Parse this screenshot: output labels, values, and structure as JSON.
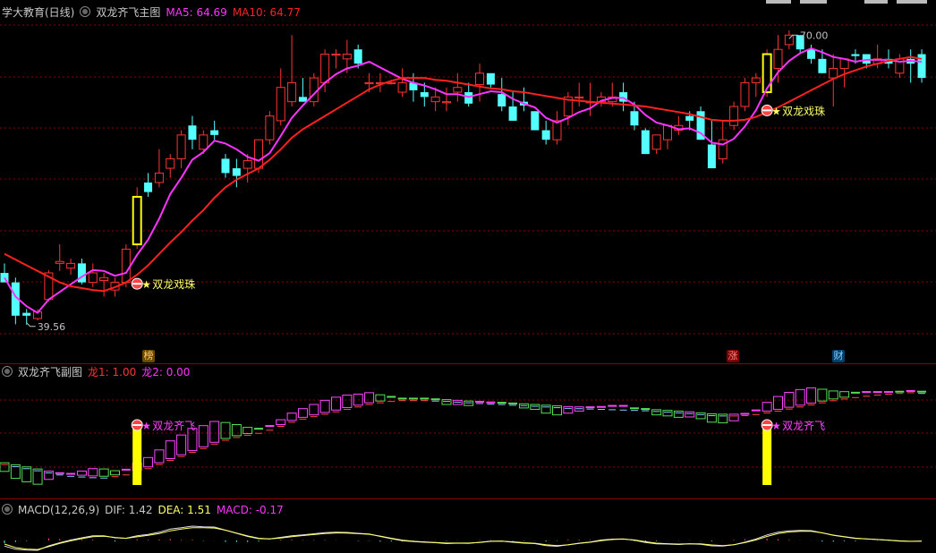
{
  "main_panel": {
    "title": "学大教育(日线)",
    "indicator_name": "双龙齐飞主图",
    "ma5_label": "MA5: 64.69",
    "ma10_label": "MA10: 64.77",
    "high_label": "70.00",
    "low_label": "39.56",
    "signal_label": "双龙戏珠",
    "events": [
      {
        "label": "榜",
        "color": "#ffcc66"
      },
      {
        "label": "涨",
        "color": "#ff6666"
      },
      {
        "label": "财",
        "color": "#66ccff"
      }
    ]
  },
  "sub_panel": {
    "indicator_name": "双龙齐飞副图",
    "long1_label": "龙1: 1.00",
    "long2_label": "龙2: 0.00",
    "signal_label": "双龙齐飞"
  },
  "macd_panel": {
    "title": "MACD(12,26,9)",
    "dif_label": "DIF: 1.42",
    "dea_label": "DEA: 1.51",
    "macd_label": "MACD: -0.17"
  },
  "colors": {
    "up": "#ff3232",
    "down": "#54ffff",
    "ma5": "#ff33ff",
    "ma10": "#ff2020",
    "signal_bar": "#ffff00",
    "grid": "#8b0000"
  },
  "chart_data": [
    {
      "type": "candlestick",
      "title": "学大教育(日线)",
      "ylim": [
        37,
        72
      ],
      "annotations": [
        {
          "text": "70.00",
          "kind": "high"
        },
        {
          "text": "39.56",
          "kind": "low"
        }
      ],
      "candles": [
        [
          45.0,
          46.0,
          44.2,
          44.0
        ],
        [
          44.0,
          44.5,
          39.6,
          40.5
        ],
        [
          40.8,
          41.2,
          39.56,
          40.5
        ],
        [
          40.2,
          41.2,
          40.0,
          40.9
        ],
        [
          42.2,
          45.3,
          42.0,
          45.0
        ],
        [
          46.0,
          48.0,
          45.2,
          46.2
        ],
        [
          45.5,
          46.5,
          44.8,
          46.0
        ],
        [
          46.0,
          46.5,
          43.8,
          44.0
        ],
        [
          44.0,
          46.0,
          43.5,
          45.0
        ],
        [
          44.2,
          45.0,
          42.5,
          44.5
        ],
        [
          43.2,
          44.5,
          42.5,
          44.0
        ],
        [
          44.0,
          48.0,
          43.5,
          47.5
        ],
        [
          48.0,
          54.0,
          47.5,
          53.0
        ],
        [
          54.5,
          55.5,
          53.0,
          53.5
        ],
        [
          54.5,
          58.0,
          54.0,
          55.5
        ],
        [
          56.0,
          57.5,
          55.0,
          57.0
        ],
        [
          57.0,
          60.0,
          56.0,
          59.5
        ],
        [
          60.5,
          61.5,
          58.0,
          59.0
        ],
        [
          58.0,
          60.0,
          57.5,
          59.5
        ],
        [
          60.0,
          61.0,
          59.0,
          59.5
        ],
        [
          57.0,
          57.5,
          55.0,
          55.5
        ],
        [
          56.0,
          57.0,
          54.0,
          55.2
        ],
        [
          56.0,
          57.5,
          54.5,
          56.8
        ],
        [
          56.0,
          59.0,
          55.5,
          59.0
        ],
        [
          59.0,
          62.0,
          58.5,
          61.5
        ],
        [
          61.0,
          66.5,
          60.5,
          64.5
        ],
        [
          63.0,
          70.0,
          62.5,
          65.0
        ],
        [
          63.5,
          65.5,
          63.0,
          63.0
        ],
        [
          63.0,
          66.0,
          62.5,
          65.5
        ],
        [
          65.0,
          68.5,
          64.0,
          68.0
        ],
        [
          68.0,
          68.5,
          66.5,
          68.0
        ],
        [
          67.5,
          69.5,
          66.0,
          68.0
        ],
        [
          68.5,
          69.0,
          66.5,
          67.0
        ],
        [
          65.0,
          66.0,
          64.0,
          65.0
        ],
        [
          65.0,
          66.0,
          64.0,
          65.0
        ],
        [
          65.0,
          65.2,
          64.8,
          65.0
        ],
        [
          64.0,
          66.5,
          63.5,
          65.0
        ],
        [
          65.0,
          66.0,
          63.0,
          64.2
        ],
        [
          64.0,
          65.0,
          62.5,
          63.5
        ],
        [
          63.0,
          64.5,
          62.0,
          63.5
        ],
        [
          63.0,
          64.5,
          62.0,
          63.0
        ],
        [
          64.0,
          66.0,
          63.0,
          64.5
        ],
        [
          64.0,
          65.0,
          62.5,
          62.8
        ],
        [
          64.8,
          67.0,
          63.0,
          66.0
        ],
        [
          66.0,
          66.0,
          64.5,
          64.8
        ],
        [
          63.8,
          65.5,
          62.0,
          62.5
        ],
        [
          62.5,
          64.0,
          61.0,
          61.0
        ],
        [
          63.0,
          64.5,
          62.0,
          62.6
        ],
        [
          62.0,
          62.0,
          60.0,
          60.0
        ],
        [
          60.0,
          61.0,
          58.5,
          59.0
        ],
        [
          59.0,
          62.0,
          58.5,
          61.0
        ],
        [
          61.5,
          64.0,
          60.5,
          63.5
        ],
        [
          63.5,
          65.0,
          62.5,
          63.5
        ],
        [
          63.0,
          65.0,
          61.5,
          63.0
        ],
        [
          63.0,
          64.0,
          62.5,
          63.5
        ],
        [
          63.0,
          65.0,
          62.5,
          63.5
        ],
        [
          64.0,
          65.0,
          62.0,
          63.0
        ],
        [
          62.0,
          63.0,
          60.0,
          60.5
        ],
        [
          60.0,
          60.2,
          57.5,
          57.5
        ],
        [
          58.0,
          59.5,
          57.5,
          59.5
        ],
        [
          59.0,
          60.5,
          58.0,
          60.5
        ],
        [
          60.0,
          61.5,
          59.5,
          60.5
        ],
        [
          61.5,
          62.0,
          60.0,
          61.0
        ],
        [
          62.0,
          62.5,
          59.0,
          59.0
        ],
        [
          58.5,
          61.0,
          56.0,
          56.0
        ],
        [
          57.0,
          61.0,
          56.5,
          59.0
        ],
        [
          60.5,
          63.0,
          60.0,
          62.5
        ],
        [
          62.5,
          65.5,
          62.0,
          65.0
        ],
        [
          65.0,
          66.0,
          63.5,
          65.5
        ],
        [
          64.0,
          68.5,
          63.5,
          68.0
        ],
        [
          66.5,
          70.0,
          65.0,
          68.5
        ],
        [
          69.0,
          70.5,
          68.5,
          70.0
        ],
        [
          70.0,
          70.0,
          68.0,
          68.5
        ],
        [
          68.5,
          69.0,
          67.0,
          67.5
        ],
        [
          67.5,
          68.5,
          66.0,
          66.0
        ],
        [
          65.5,
          68.0,
          62.5,
          66.5
        ],
        [
          66.5,
          67.5,
          64.5,
          67.5
        ],
        [
          68.0,
          68.5,
          67.0,
          67.8
        ],
        [
          68.0,
          68.0,
          66.5,
          67.0
        ],
        [
          67.0,
          69.0,
          66.5,
          67.5
        ],
        [
          67.5,
          68.5,
          66.5,
          67.0
        ],
        [
          66.0,
          68.0,
          65.5,
          67.5
        ],
        [
          67.5,
          68.5,
          65.0,
          67.0
        ],
        [
          68.0,
          68.5,
          65.0,
          65.5
        ]
      ],
      "series": [
        {
          "name": "MA5",
          "values": [
            44.5,
            42.5,
            41.5,
            40.8,
            42.2,
            43.0,
            43.8,
            44.6,
            45.3,
            45.2,
            44.7,
            45.0,
            46.9,
            48.5,
            50.7,
            53.3,
            55.0,
            56.9,
            57.7,
            58.9,
            58.6,
            58.0,
            57.2,
            56.8,
            57.6,
            59.4,
            61.3,
            62.6,
            63.8,
            65.0,
            65.9,
            66.5,
            66.8,
            67.2,
            66.6,
            66.0,
            65.4,
            65.0,
            64.7,
            64.3,
            63.8,
            63.8,
            63.5,
            63.8,
            64.1,
            64.0,
            63.3,
            62.8,
            62.4,
            61.3,
            60.8,
            61.3,
            61.9,
            62.3,
            63.1,
            63.4,
            63.4,
            62.7,
            61.6,
            60.8,
            60.5,
            60.1,
            60.2,
            59.7,
            58.7,
            58.5,
            59.1,
            60.4,
            62.1,
            64.4,
            66.1,
            67.3,
            68.1,
            68.6,
            68.2,
            67.7,
            67.5,
            67.2,
            67.4,
            67.4,
            67.4,
            67.2,
            67.3,
            67.2
          ]
        },
        {
          "name": "MA10",
          "values": [
            47.0,
            46.4,
            45.8,
            45.2,
            44.6,
            44.0,
            43.6,
            43.4,
            43.2,
            43.1,
            43.5,
            44.0,
            44.8,
            45.8,
            47.0,
            48.2,
            49.3,
            50.5,
            51.6,
            52.9,
            54.0,
            54.8,
            55.4,
            56.0,
            56.9,
            58.0,
            59.2,
            60.1,
            60.8,
            61.5,
            62.2,
            62.9,
            63.6,
            64.3,
            64.8,
            65.2,
            65.5,
            65.5,
            65.5,
            65.3,
            65.2,
            65.0,
            64.8,
            64.6,
            64.4,
            64.3,
            64.1,
            64.0,
            63.8,
            63.6,
            63.4,
            63.2,
            63.1,
            63.0,
            62.9,
            62.8,
            62.7,
            62.6,
            62.5,
            62.3,
            62.1,
            61.9,
            61.7,
            61.4,
            61.1,
            61.0,
            61.0,
            61.1,
            61.4,
            61.9,
            62.4,
            63.0,
            63.6,
            64.2,
            64.8,
            65.4,
            65.9,
            66.3,
            66.7,
            67.0,
            67.3,
            67.5,
            67.7,
            67.5
          ]
        }
      ]
    },
    {
      "type": "bar",
      "title": "双龙齐飞副图",
      "series": [
        {
          "name": "龙1",
          "values": [
            1.0
          ]
        },
        {
          "name": "龙2",
          "values": [
            0.0
          ]
        }
      ]
    },
    {
      "type": "line",
      "title": "MACD(12,26,9)",
      "series": [
        {
          "name": "DIF",
          "values": [
            1.42
          ]
        },
        {
          "name": "DEA",
          "values": [
            1.51
          ]
        },
        {
          "name": "MACD",
          "values": [
            -0.17
          ]
        }
      ]
    }
  ]
}
